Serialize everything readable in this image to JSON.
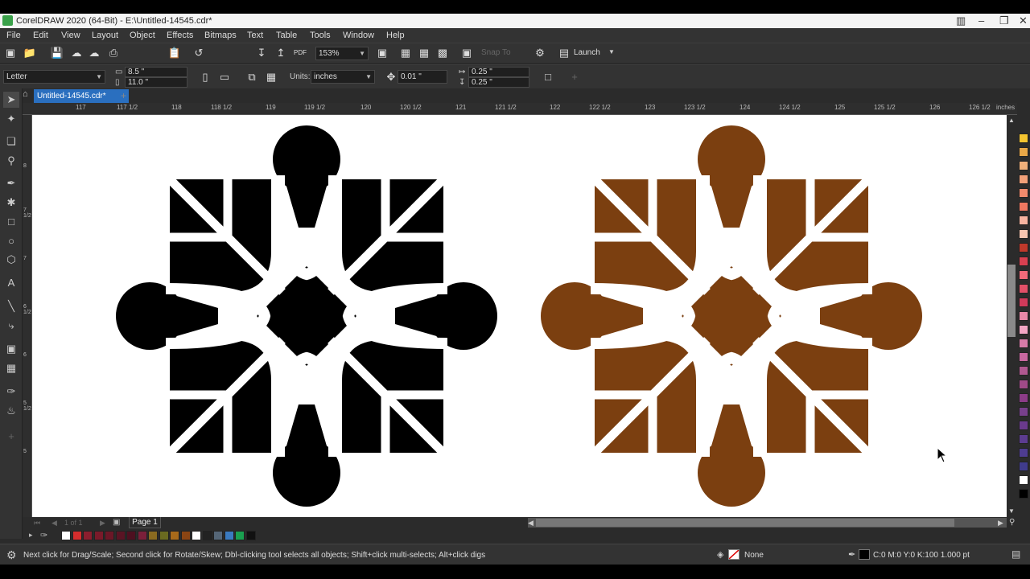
{
  "titlebar": {
    "title": "CorelDRAW 2020 (64-Bit) - E:\\Untitled-14545.cdr*"
  },
  "menus": [
    "File",
    "Edit",
    "View",
    "Layout",
    "Object",
    "Effects",
    "Bitmaps",
    "Text",
    "Table",
    "Tools",
    "Window",
    "Help"
  ],
  "toolbar": {
    "zoom": "153%",
    "snap_to": "Snap To",
    "launch": "Launch"
  },
  "propertybar": {
    "page_size": "Letter",
    "width": "8.5 \"",
    "height": "11.0 \"",
    "units_label": "Units:",
    "units": "inches",
    "nudge": "0.01 \"",
    "dup_x": "0.25 \"",
    "dup_y": "0.25 \""
  },
  "document_tab": "Untitled-14545.cdr*",
  "ruler": {
    "labels": [
      "117",
      "117 1/2",
      "118",
      "118 1/2",
      "119",
      "119 1/2",
      "120",
      "120 1/2",
      "121",
      "121 1/2",
      "122",
      "122 1/2",
      "123",
      "123 1/2",
      "124",
      "124 1/2",
      "125",
      "125 1/2",
      "126",
      "126 1/2"
    ],
    "unit": "inches"
  },
  "vruler_labels": [
    "8",
    "7 1/2",
    "7",
    "6 1/2",
    "6",
    "5 1/2",
    "5"
  ],
  "page_navigator": {
    "page_tab": "Page 1",
    "counter": "1 of 1"
  },
  "status": {
    "hint": "Next click for Drag/Scale; Second click for Rotate/Skew; Dbl-clicking tool selects all objects; Shift+click multi-selects; Alt+click digs",
    "fill": "None",
    "outline": "C:0 M:0 Y:0 K:100  1.000 pt"
  },
  "colors": {
    "shape_left": "#000000",
    "shape_right": "#7b3f10",
    "accent_tab": "#2a6fbf"
  },
  "palette_colors": [
    "#f4c430",
    "#e9a848",
    "#f1b07a",
    "#f2a079",
    "#f28a6c",
    "#f07860",
    "#f5b3a0",
    "#f7c5b0",
    "#c0392b",
    "#d94050",
    "#f26a7a",
    "#e25068",
    "#d03a5a",
    "#e889a8",
    "#f2a6c4",
    "#d87aa8",
    "#c868a0",
    "#b05890",
    "#a04a88",
    "#8c3c88",
    "#78408c",
    "#6a3a8c",
    "#5c3c90",
    "#4e3c90",
    "#403c8c",
    "#ffffff",
    "#000000"
  ],
  "doc_palette": [
    "#ffffff",
    "#d42d2d",
    "#8b1e2e",
    "#7a1a2a",
    "#6b1727",
    "#5a1424",
    "#4d1020",
    "#7b1f3a",
    "#8a6a20",
    "#6a6a20",
    "#a86a1a",
    "#8b4513",
    "#ffffff",
    "#222222",
    "#556677",
    "#3a7ac0",
    "#1aa050",
    "#111111"
  ]
}
